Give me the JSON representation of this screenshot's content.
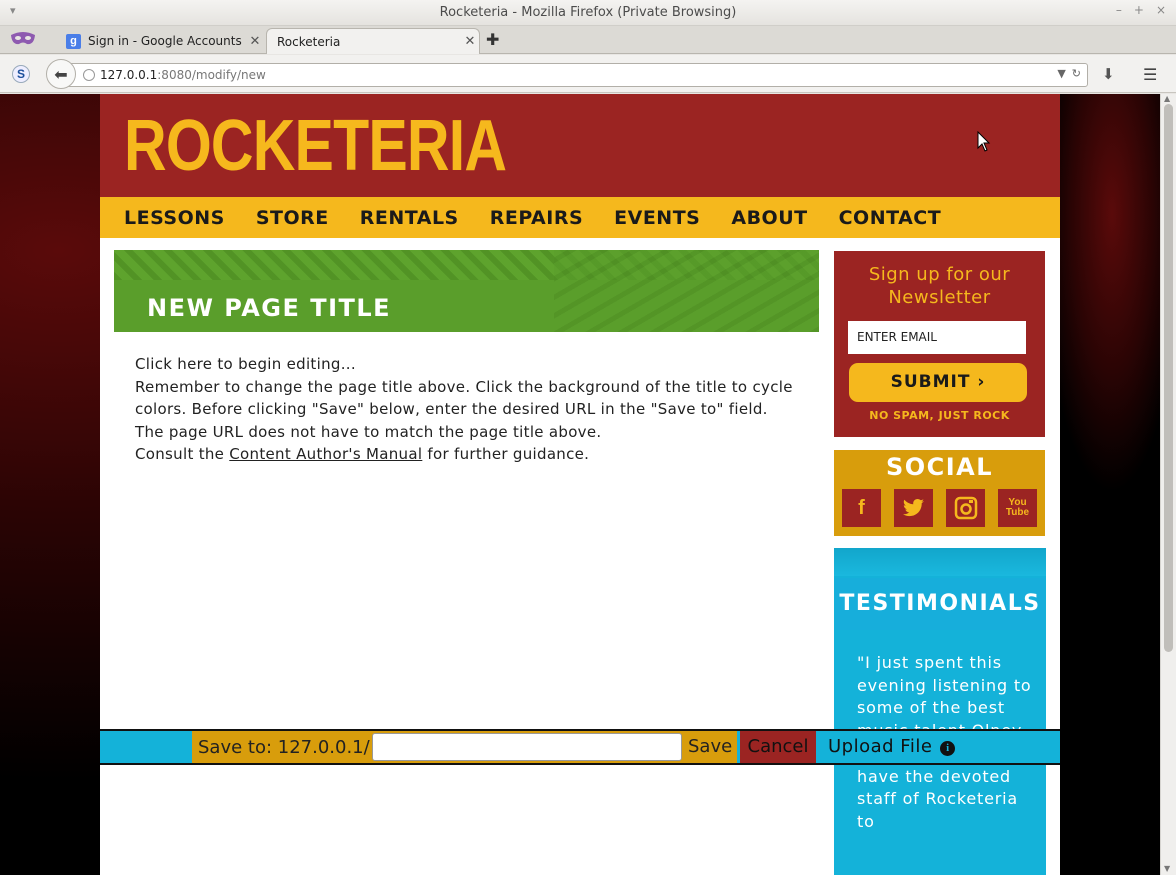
{
  "window": {
    "title": "Rocketeria - Mozilla Firefox (Private Browsing)"
  },
  "tabs": [
    {
      "label": "Sign in - Google Accounts",
      "icon": "google-icon"
    },
    {
      "label": "Rocketeria",
      "icon": "none"
    }
  ],
  "urlbar": {
    "host": "127.0.0.1",
    "path": ":8080/modify/new"
  },
  "site": {
    "logo": "ROCKETERIA",
    "nav": [
      "LESSONS",
      "STORE",
      "RENTALS",
      "REPAIRS",
      "EVENTS",
      "ABOUT",
      "CONTACT"
    ],
    "page_title": "NEW PAGE TITLE",
    "content": {
      "line1": "Click here to begin editing...",
      "line2": "Remember to change the page title above. Click the background of the title to cycle colors. Before clicking \"Save\" below, enter the desired URL in the \"Save to\" field. The page URL does not have to match the page title above.",
      "line3_prefix": "Consult the ",
      "manual_link": "Content Author's Manual",
      "line3_suffix": " for further guidance."
    },
    "newsletter": {
      "title": "Sign up for our Newsletter",
      "email_placeholder": "ENTER EMAIL",
      "submit": "SUBMIT",
      "no_spam": "NO SPAM, JUST ROCK"
    },
    "social": {
      "title": "SOCIAL",
      "icons": [
        "facebook-icon",
        "twitter-icon",
        "instagram-icon",
        "youtube-icon"
      ]
    },
    "testimonials": {
      "title": "TESTIMONIALS",
      "quote": "\"I just spent this evening listening to some of the best music talent Olney has to offer and I have the devoted staff of Rocketeria to"
    }
  },
  "savebar": {
    "save_to_label": "Save to: 127.0.0.1/",
    "save_to_value": "",
    "save": "Save",
    "cancel": "Cancel",
    "upload": "Upload File"
  },
  "colors": {
    "header_red": "#9b2422",
    "nav_yellow": "#f5b81d",
    "title_green": "#5a9e2b",
    "social_gold": "#d89d0c",
    "testimonial_blue": "#14b2d9"
  }
}
